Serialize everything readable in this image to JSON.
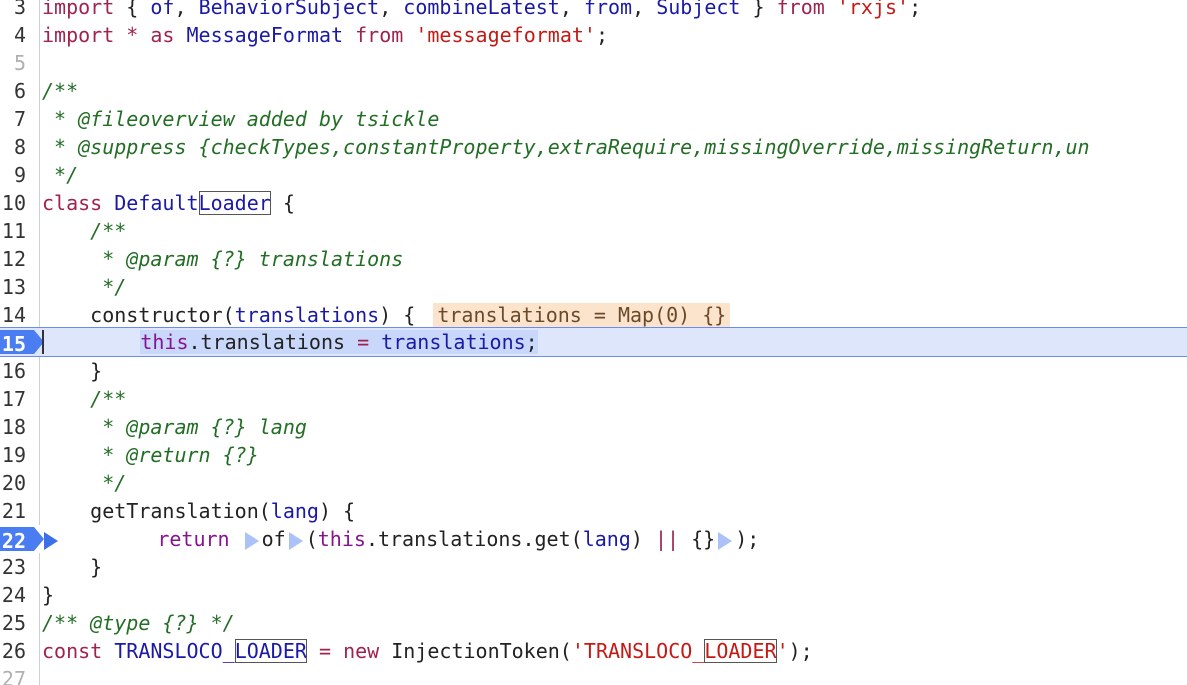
{
  "lines": {
    "l3": {
      "num": "3",
      "import": "import",
      "brace_open": " { ",
      "of": "of",
      "comma1": ", ",
      "bs": "BehaviorSubject",
      "comma2": ", ",
      "cl": "combineLatest",
      "comma3": ", ",
      "from": "from",
      "comma4": ", ",
      "subj": "Subject",
      "brace_close": " } ",
      "from2": "from",
      "sp": " ",
      "src": "'rxjs'",
      "semi": ";"
    },
    "l4": {
      "num": "4",
      "import": "import",
      "star": " * ",
      "as": "as",
      "sp": " ",
      "name": "MessageFormat",
      "sp2": " ",
      "from": "from",
      "sp3": " ",
      "src": "'messageformat'",
      "semi": ";"
    },
    "l5": {
      "num": "5"
    },
    "l6": {
      "num": "6",
      "text": "/**"
    },
    "l7": {
      "num": "7",
      "text": " * @fileoverview added by tsickle"
    },
    "l8": {
      "num": "8",
      "text": " * @suppress {checkTypes,constantProperty,extraRequire,missingOverride,missingReturn,un"
    },
    "l9": {
      "num": "9",
      "text": " */"
    },
    "l10": {
      "num": "10",
      "class": "class",
      "sp": " ",
      "name_a": "Default",
      "name_b": "Loader",
      "rest": " {"
    },
    "l11": {
      "num": "11",
      "text": "    /**"
    },
    "l12": {
      "num": "12",
      "text": "     * @param {?} translations"
    },
    "l13": {
      "num": "13",
      "text": "     */"
    },
    "l14": {
      "num": "14",
      "indent": "    ",
      "ctor": "constructor(",
      "param": "translations",
      "rest": ") { ",
      "inline_value": "translations = Map(0) {}"
    },
    "l15": {
      "num": "15",
      "indent": "        ",
      "this": "this",
      "dot": ".",
      "prop": "translations",
      "eq": " = ",
      "val": "translations",
      "semi": ";"
    },
    "l16": {
      "num": "16",
      "text": "    }"
    },
    "l17": {
      "num": "17",
      "text": "    /**"
    },
    "l18": {
      "num": "18",
      "text": "     * @param {?} lang"
    },
    "l19": {
      "num": "19",
      "text": "     * @return {?}"
    },
    "l20": {
      "num": "20",
      "text": "     */"
    },
    "l21": {
      "num": "21",
      "indent": "    ",
      "fn": "getTranslation(",
      "param": "lang",
      "rest": ") {"
    },
    "l22": {
      "num": "22",
      "indent": "        ",
      "ret": "return",
      "sp": " ",
      "of": "of",
      "paren": "(",
      "this": "this",
      "rest1": ".translations.get(",
      "param": "lang",
      "rest2": ") ",
      "or": "||",
      "sp2": " ",
      "obj": "{}",
      "end": ");"
    },
    "l23": {
      "num": "23",
      "text": "    }"
    },
    "l24": {
      "num": "24",
      "text": "}"
    },
    "l25": {
      "num": "25",
      "text": "/** @type {?} */"
    },
    "l26": {
      "num": "26",
      "const": "const",
      "sp": " ",
      "name_a": "TRANSLOCO_",
      "name_b": "LOADER",
      "eq": " = ",
      "new": "new",
      "sp2": " ",
      "ctor": "InjectionToken(",
      "str_a": "'TRANSLOCO_",
      "str_b": "LOADER",
      "str_c": "'",
      "end": ");"
    },
    "l27": {
      "num": "27"
    }
  }
}
